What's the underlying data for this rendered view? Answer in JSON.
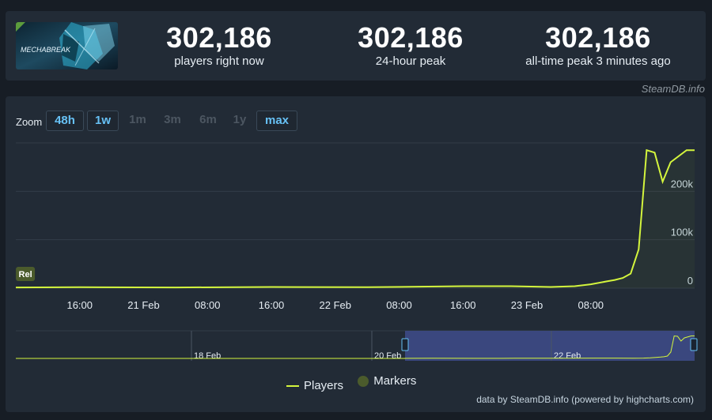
{
  "stats": [
    {
      "value": "302,186",
      "label": "players right now"
    },
    {
      "value": "302,186",
      "label": "24-hour peak"
    },
    {
      "value": "302,186",
      "label": "all-time peak 3 minutes ago"
    }
  ],
  "game": {
    "logo_text": "MECHABREAK",
    "badge_color": "#5c9c3c"
  },
  "credit_top": "SteamDB.info",
  "zoom": {
    "label": "Zoom",
    "buttons": [
      {
        "label": "48h",
        "active": true
      },
      {
        "label": "1w",
        "active": true
      },
      {
        "label": "1m",
        "active": false
      },
      {
        "label": "3m",
        "active": false
      },
      {
        "label": "6m",
        "active": false
      },
      {
        "label": "1y",
        "active": false
      },
      {
        "label": "max",
        "active": true
      }
    ]
  },
  "chart_data": {
    "type": "line",
    "x_ticks": [
      "16:00",
      "21 Feb",
      "08:00",
      "16:00",
      "22 Feb",
      "08:00",
      "16:00",
      "23 Feb",
      "08:00"
    ],
    "y_ticks": [
      "0",
      "100k",
      "200k"
    ],
    "ylim": [
      0,
      300000
    ],
    "series": [
      {
        "name": "Players",
        "color": "#d4f53d",
        "x_hours": [
          0,
          8,
          20,
          32,
          44,
          56,
          62,
          67,
          70,
          72,
          74,
          75,
          76,
          77,
          78,
          79,
          80,
          81,
          82,
          84,
          85
        ],
        "values": [
          1500,
          2000,
          1500,
          2500,
          2000,
          4000,
          4000,
          2500,
          4000,
          8000,
          14000,
          17000,
          21000,
          30000,
          80000,
          285000,
          280000,
          220000,
          260000,
          285000,
          285000
        ]
      }
    ],
    "markers": [
      {
        "label": "Rel",
        "x_hours": 1
      }
    ],
    "navigator": {
      "labels": [
        "18 Feb",
        "20 Feb",
        "22 Feb"
      ]
    },
    "legend": [
      "Players",
      "Markers"
    ]
  },
  "credit_bottom": "data by SteamDB.info (powered by highcharts.com)"
}
